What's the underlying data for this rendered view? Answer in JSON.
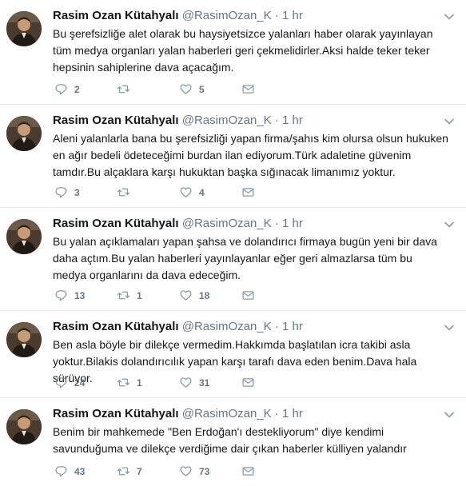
{
  "tweets": [
    {
      "fullname": "Rasim Ozan Kütahyalı",
      "handle": "@RasimOzan_K",
      "dot": "·",
      "time": "1 hr",
      "text": "Bu şerefsizliğe alet olarak bu haysiyetsizce yalanları haber olarak yayınlayan tüm medya organları yalan haberleri geri çekmelidirler.Aksi halde teker teker hepsinin sahiplerine dava açacağım.",
      "replies": "2",
      "retweets": "",
      "likes": "5"
    },
    {
      "fullname": "Rasim Ozan Kütahyalı",
      "handle": "@RasimOzan_K",
      "dot": "·",
      "time": "1 hr",
      "text": "Aleni yalanlarla bana bu şerefsizliği yapan firma/şahıs kim olursa olsun hukuken en ağır bedeli ödeteceğimi burdan ilan ediyorum.Türk adaletine güvenim tamdır.Bu alçaklara karşı hukuktan başka sığınacak limanımız yoktur.",
      "replies": "3",
      "retweets": "",
      "likes": "4"
    },
    {
      "fullname": "Rasim Ozan Kütahyalı",
      "handle": "@RasimOzan_K",
      "dot": "·",
      "time": "1 hr",
      "text": "Bu yalan açıklamaları yapan şahsa ve dolandırıcı firmaya bugün yeni bir dava daha açtım.Bu yalan haberleri yayınlayanlar eğer geri almazlarsa tüm bu medya organlarını da dava edeceğim.",
      "replies": "13",
      "retweets": "1",
      "likes": "18"
    },
    {
      "fullname": "Rasim Ozan Kütahyalı",
      "handle": "@RasimOzan_K",
      "dot": "·",
      "time": "1 hr",
      "text": "Ben asla böyle bir dilekçe vermedim.Hakkımda başlatılan icra takibi asla yoktur.Bilakis dolandırıcılık yapan karşı tarafı dava eden benim.Dava hala sürüyor.",
      "replies": "24",
      "retweets": "1",
      "likes": "31"
    },
    {
      "fullname": "Rasim Ozan Kütahyalı",
      "handle": "@RasimOzan_K",
      "dot": "·",
      "time": "1 hr",
      "text": "Benim bir mahkemede \"Ben Erdoğan'ı destekliyorum\" diye kendimi savunduğuma ve dilekçe verdiğime dair çıkan haberler külliyen yalandır",
      "replies": "43",
      "retweets": "7",
      "likes": "73"
    }
  ],
  "icons": {
    "reply": "reply-icon",
    "retweet": "retweet-icon",
    "like": "heart-icon",
    "dm": "envelope-icon",
    "more": "chevron-down-icon"
  },
  "colors": {
    "name": "#14171a",
    "meta": "#657786",
    "divider": "#e6ecf0"
  }
}
